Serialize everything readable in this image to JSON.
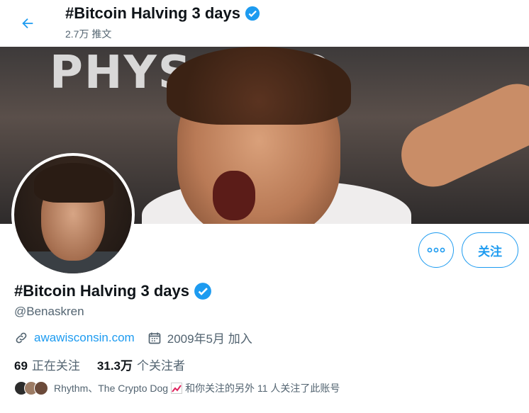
{
  "header": {
    "title": "#Bitcoin Halving 3 days",
    "tweet_count": "2.7万 推文"
  },
  "profile": {
    "name": "#Bitcoin Halving 3 days",
    "handle": "@Benaskren",
    "website": "awawisconsin.com",
    "joined": "2009年5月 加入",
    "following_count": "69",
    "following_label": "正在关注",
    "followers_count": "31.3万",
    "followers_label": "个关注者",
    "follow_button": "关注",
    "followers_you_know": {
      "names": "Rhythm、The Crypto Dog",
      "suffix": "和你关注的另外 11 人关注了此账号"
    },
    "banner_sign": "PHYS    V.CO"
  },
  "colors": {
    "accent": "#1d9bf0",
    "muted": "#536471",
    "text": "#0f1419"
  }
}
